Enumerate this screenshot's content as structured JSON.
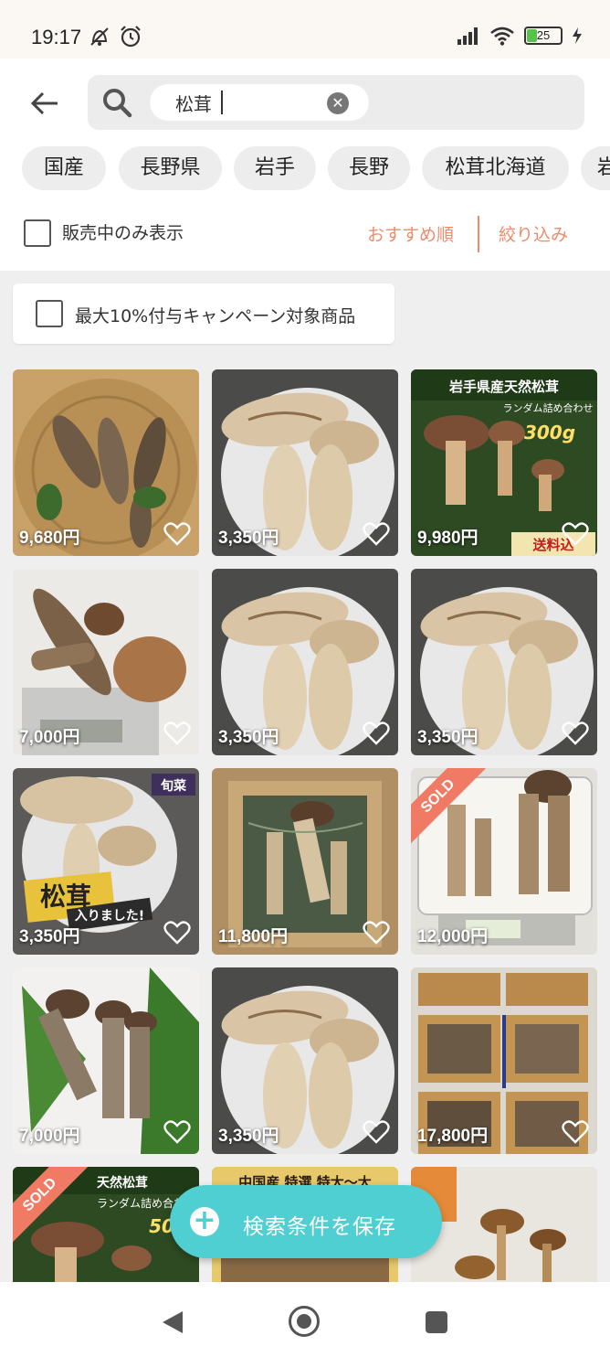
{
  "status_bar": {
    "time": "19:17",
    "battery": "25"
  },
  "search": {
    "query": "松茸",
    "clear_icon": "close-icon"
  },
  "tags": [
    "国産",
    "長野県",
    "岩手",
    "長野",
    "松茸北海道",
    "岩"
  ],
  "filters": {
    "on_sale_only": "販売中のみ表示",
    "sort": "おすすめ順",
    "refine": "絞り込み",
    "campaign": "最大10%付与キャンペーン対象商品"
  },
  "products": [
    {
      "price": "9,680円",
      "sold": false,
      "overlay": ""
    },
    {
      "price": "3,350円",
      "sold": false,
      "overlay": ""
    },
    {
      "price": "9,980円",
      "sold": false,
      "overlay": "岩手県産天然松茸 ランダム詰め合わせ 300g 送料込"
    },
    {
      "price": "7,000円",
      "sold": false,
      "overlay": ""
    },
    {
      "price": "3,350円",
      "sold": false,
      "overlay": ""
    },
    {
      "price": "3,350円",
      "sold": false,
      "overlay": ""
    },
    {
      "price": "3,350円",
      "sold": false,
      "overlay": "松茸 入りました! 旬菜"
    },
    {
      "price": "11,800円",
      "sold": false,
      "overlay": ""
    },
    {
      "price": "12,000円",
      "sold": true,
      "overlay": ""
    },
    {
      "price": "7,000円",
      "sold": false,
      "overlay": ""
    },
    {
      "price": "3,350円",
      "sold": false,
      "overlay": ""
    },
    {
      "price": "17,800円",
      "sold": false,
      "overlay": ""
    },
    {
      "price": "",
      "sold": true,
      "overlay": "天然松茸 ランダム詰め合わせ 500"
    },
    {
      "price": "",
      "sold": false,
      "overlay": "中国産 特選 特大〜大"
    },
    {
      "price": "",
      "sold": false,
      "overlay": ""
    }
  ],
  "sold_label": "SOLD",
  "fab": {
    "label": "検索条件を保存"
  },
  "colors": {
    "accent": "#f08a6b",
    "fab": "#4fcfd1",
    "sold": "#f07a63"
  }
}
